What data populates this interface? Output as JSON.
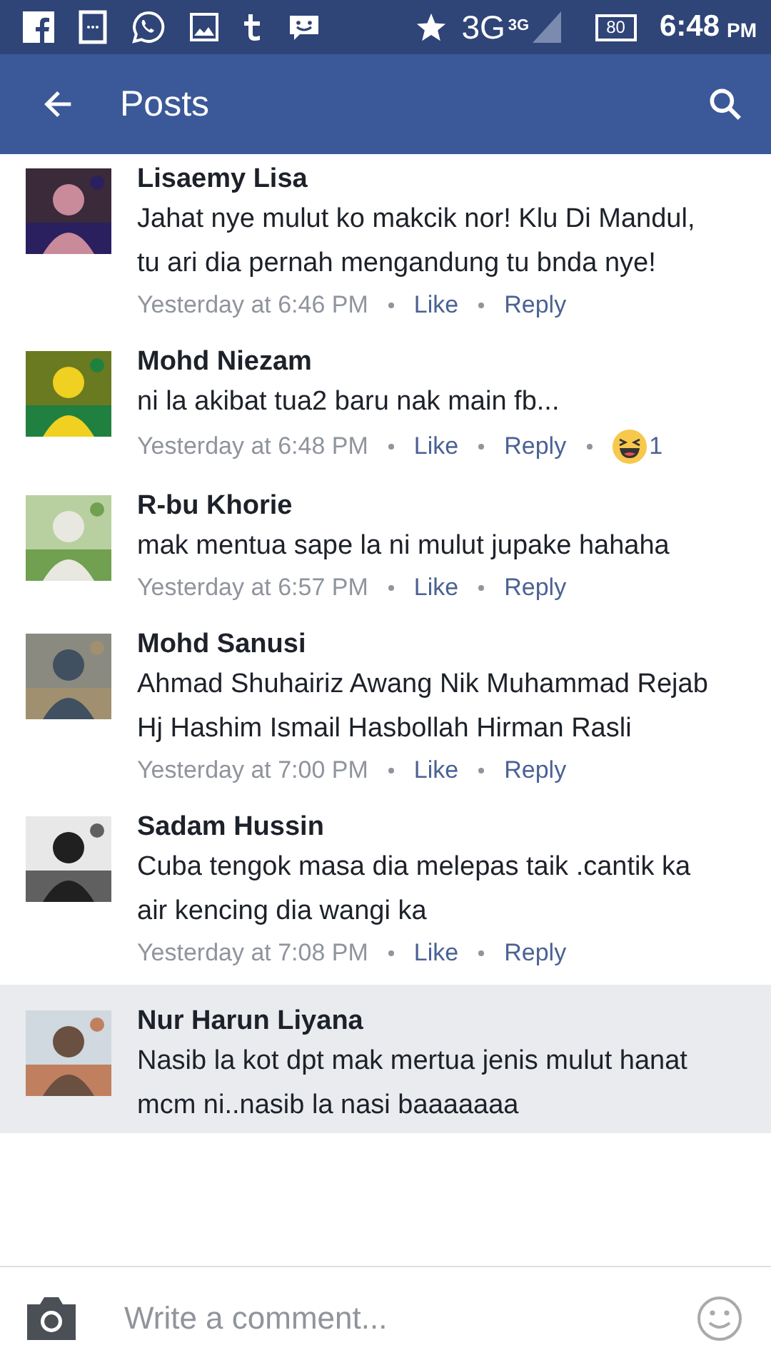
{
  "status_bar": {
    "network": "3G",
    "network_sup": "3G",
    "battery": "80",
    "time": "6:48",
    "meridiem": "PM"
  },
  "header": {
    "title": "Posts"
  },
  "comments": [
    {
      "author": "Lisaemy Lisa",
      "text": "Jahat nye mulut ko makcik nor! Klu Di Mandul, tu ari dia pernah mengandung tu bnda nye!",
      "time": "Yesterday at 6:46 PM",
      "like": "Like",
      "reply": "Reply",
      "highlighted": false
    },
    {
      "author": "Mohd Niezam",
      "text": "ni la akibat tua2 baru nak main fb...",
      "time": "Yesterday at 6:48 PM",
      "like": "Like",
      "reply": "Reply",
      "highlighted": false,
      "reaction_count": "1"
    },
    {
      "author": "R-bu Khorie",
      "text": "mak mentua sape la ni mulut jupake hahaha",
      "time": "Yesterday at 6:57 PM",
      "like": "Like",
      "reply": "Reply",
      "highlighted": false
    },
    {
      "author": "Mohd Sanusi",
      "text": "Ahmad Shuhairiz Awang Nik Muhammad Rejab Hj Hashim Ismail Hasbollah Hirman Rasli",
      "time": "Yesterday at 7:00 PM",
      "like": "Like",
      "reply": "Reply",
      "highlighted": false
    },
    {
      "author": "Sadam Hussin",
      "text": "Cuba tengok masa dia melepas taik .cantik ka air kencing dia wangi ka",
      "time": "Yesterday at 7:08 PM",
      "like": "Like",
      "reply": "Reply",
      "highlighted": false
    },
    {
      "author": "Nur Harun Liyana",
      "text": "Nasib la kot dpt mak mertua jenis mulut hanat mcm ni..nasib la nasi baaaaaaa",
      "highlighted": true
    }
  ],
  "composer": {
    "placeholder": "Write a comment..."
  }
}
